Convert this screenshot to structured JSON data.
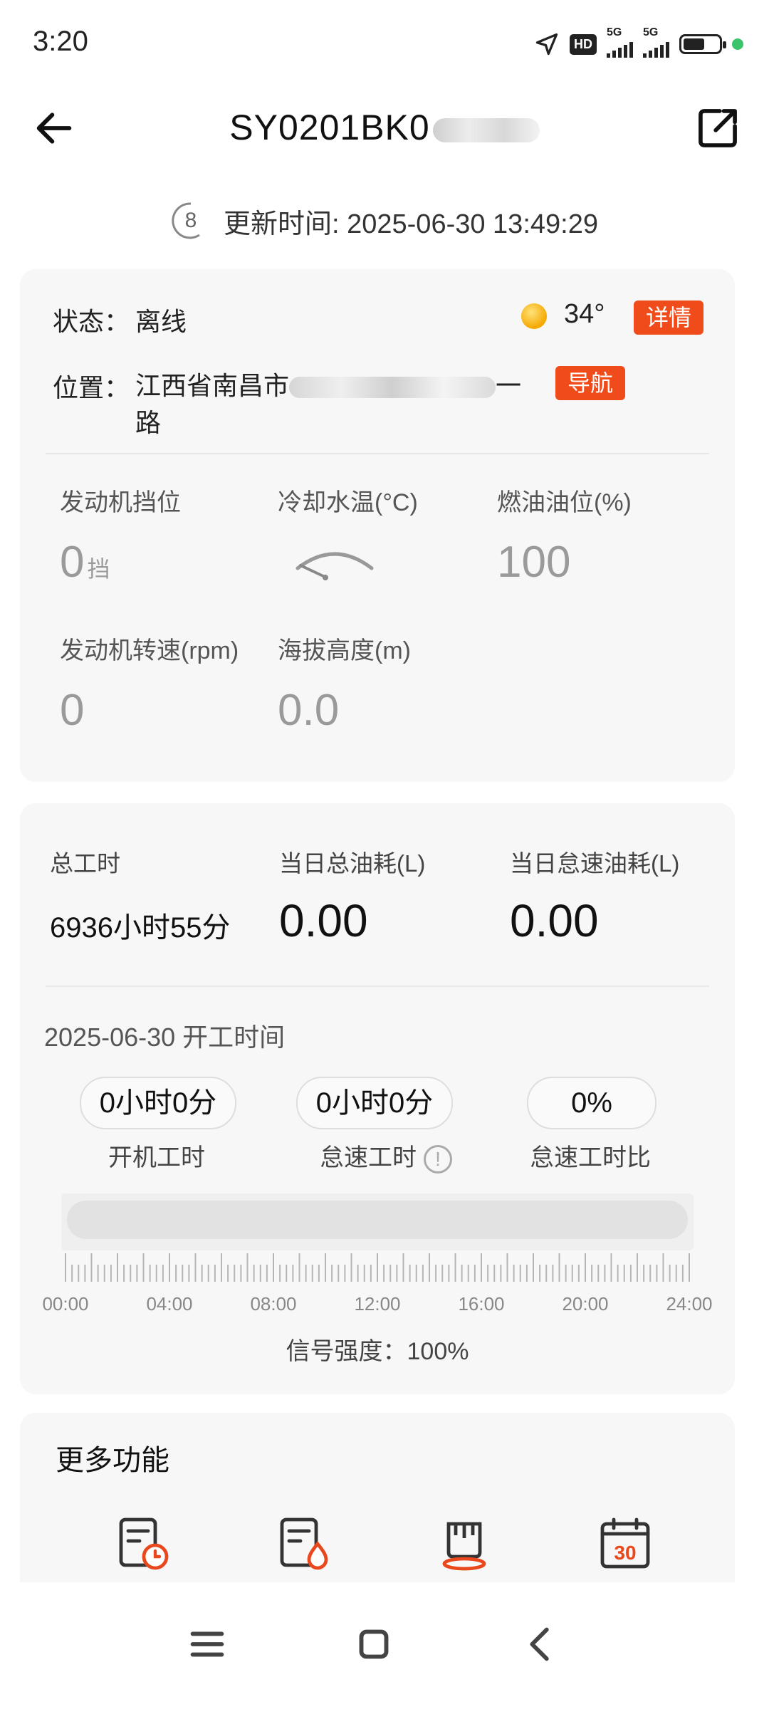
{
  "status_bar": {
    "time": "3:20",
    "hd_label": "HD",
    "network_1": "5G",
    "network_2": "5G",
    "battery_level": 0.6,
    "dot_color": "#3cc46a"
  },
  "header": {
    "title": "SY0201BK0",
    "back_icon": "arrow-left-icon",
    "share_icon": "external-link-icon"
  },
  "update": {
    "countdown": "8",
    "text": "更新时间: 2025-06-30 13:49:29"
  },
  "device": {
    "status_label": "状态：",
    "status_value": "离线",
    "weather_icon": "sun-icon",
    "temperature": "34°",
    "detail_button": "详情",
    "location_label": "位置：",
    "location_prefix": "江西省南昌市",
    "location_suffix": "一",
    "location_line2": "路",
    "nav_button": "导航",
    "accent_color": "#f04b1a"
  },
  "metrics": {
    "gear_label": "发动机挡位",
    "gear_value": "0",
    "gear_unit": "挡",
    "coolant_label": "冷却水温(°C)",
    "fuel_label": "燃油油位(%)",
    "fuel_value": "100",
    "rpm_label": "发动机转速(rpm)",
    "rpm_value": "0",
    "altitude_label": "海拔高度(m)",
    "altitude_value": "0.0"
  },
  "work": {
    "total_label": "总工时",
    "total_value": "6936小时55分",
    "daily_fuel_label": "当日总油耗(L)",
    "daily_fuel_value": "0.00",
    "idle_fuel_label": "当日怠速油耗(L)",
    "idle_fuel_value": "0.00",
    "date_line": "2025-06-30 开工时间",
    "on_time_value": "0小时0分",
    "on_time_label": "开机工时",
    "idle_time_value": "0小时0分",
    "idle_time_label": "怠速工时",
    "idle_ratio_value": "0%",
    "idle_ratio_label": "怠速工时比",
    "info_glyph": "!",
    "timeline_labels": [
      "00:00",
      "04:00",
      "08:00",
      "12:00",
      "16:00",
      "20:00",
      "24:00"
    ],
    "signal": "信号强度：100%"
  },
  "more": {
    "title": "更多功能",
    "icons": [
      "work-time-report-icon",
      "fuel-report-icon",
      "excavator-bucket-icon",
      "calendar-icon"
    ],
    "calendar_day": "30"
  },
  "nav_bar": {
    "icons": [
      "menu-icon",
      "home-square-icon",
      "back-chevron-icon"
    ]
  }
}
